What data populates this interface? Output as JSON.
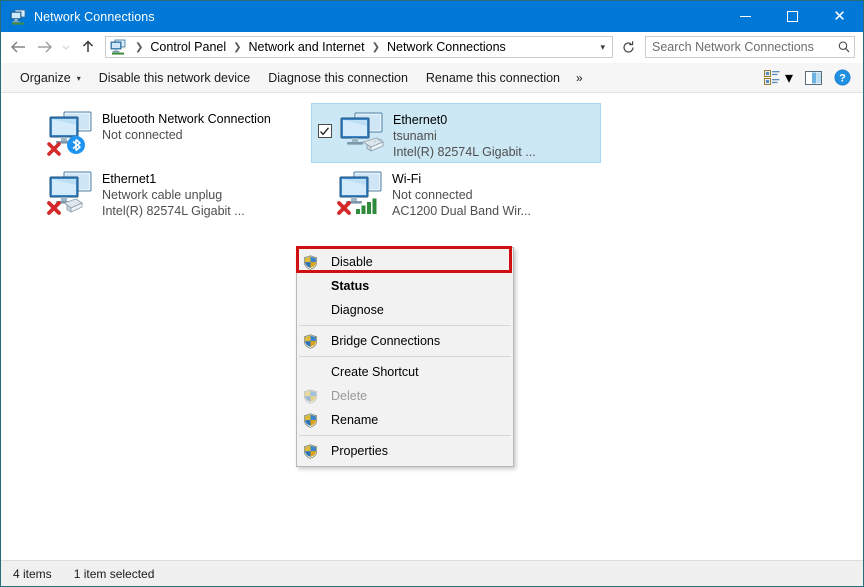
{
  "window": {
    "title": "Network Connections",
    "title_icon": "network-connections-icon",
    "minimize_label": "–",
    "maximize_label": "□",
    "close_label": "✕"
  },
  "address_bar": {
    "back_icon": "back-arrow-icon",
    "forward_icon": "forward-arrow-icon",
    "recent_icon": "recent-locations-icon",
    "up_icon": "up-arrow-icon",
    "location_icon": "network-connections-icon",
    "breadcrumbs": [
      "Control Panel",
      "Network and Internet",
      "Network Connections"
    ],
    "separator": "❯",
    "dropdown_caret": "▾",
    "refresh_icon": "refresh-icon",
    "refresh_glyph": "↻"
  },
  "search": {
    "placeholder": "Search Network Connections",
    "value": "",
    "icon": "search-icon"
  },
  "command_bar": {
    "organize": "Organize",
    "organize_caret": "▾",
    "disable_device": "Disable this network device",
    "diagnose_connection": "Diagnose this connection",
    "rename_connection": "Rename this connection",
    "overflow": "»",
    "view_icon": "view-options-icon",
    "view_caret": "▾",
    "pane_icon": "preview-pane-icon",
    "help_icon": "help-icon",
    "help_glyph": "?"
  },
  "connections": [
    {
      "name": "Bluetooth Network Connection",
      "status": "Not connected",
      "device": "",
      "selected": false,
      "checked": false,
      "icon": "network-adapter-icon",
      "overlay": "bluetooth-icon",
      "error_overlay": "red-x-icon"
    },
    {
      "name": "Ethernet0",
      "status": "tsunami",
      "device": "Intel(R) 82574L Gigabit ...",
      "selected": true,
      "checked": true,
      "icon": "network-adapter-icon",
      "overlay": "ethernet-cable-icon",
      "error_overlay": ""
    },
    {
      "name": "Ethernet1",
      "status": "Network cable unplug",
      "device": "Intel(R) 82574L Gigabit ...",
      "selected": false,
      "checked": false,
      "icon": "network-adapter-icon",
      "overlay": "ethernet-cable-icon",
      "error_overlay": "red-x-icon"
    },
    {
      "name": "Wi-Fi",
      "status": "Not connected",
      "device": "AC1200  Dual Band Wir...",
      "selected": false,
      "checked": false,
      "icon": "network-adapter-icon",
      "overlay": "wifi-signal-icon",
      "error_overlay": "red-x-icon"
    }
  ],
  "context_menu": {
    "items": [
      {
        "label": "Disable",
        "shield": true,
        "bold": false,
        "disabled": false,
        "highlighted": true
      },
      {
        "label": "Status",
        "shield": false,
        "bold": true,
        "disabled": false,
        "highlighted": false
      },
      {
        "label": "Diagnose",
        "shield": false,
        "bold": false,
        "disabled": false,
        "highlighted": false
      },
      {
        "label": "Bridge Connections",
        "shield": true,
        "bold": false,
        "disabled": false,
        "highlighted": false
      },
      {
        "label": "Create Shortcut",
        "shield": false,
        "bold": false,
        "disabled": false,
        "highlighted": false
      },
      {
        "label": "Delete",
        "shield": true,
        "bold": false,
        "disabled": true,
        "highlighted": false
      },
      {
        "label": "Rename",
        "shield": true,
        "bold": false,
        "disabled": false,
        "highlighted": false
      },
      {
        "label": "Properties",
        "shield": true,
        "bold": false,
        "disabled": false,
        "highlighted": false
      }
    ],
    "separators_after": [
      2,
      3,
      6
    ],
    "highlight_color": "#d01010"
  },
  "status_bar": {
    "item_count": "4 items",
    "selection": "1 item selected"
  },
  "colors": {
    "titlebar": "#0078d7",
    "selection": "#cce8f4",
    "window_border": "#2c6b78",
    "red_highlight": "#d01010"
  }
}
